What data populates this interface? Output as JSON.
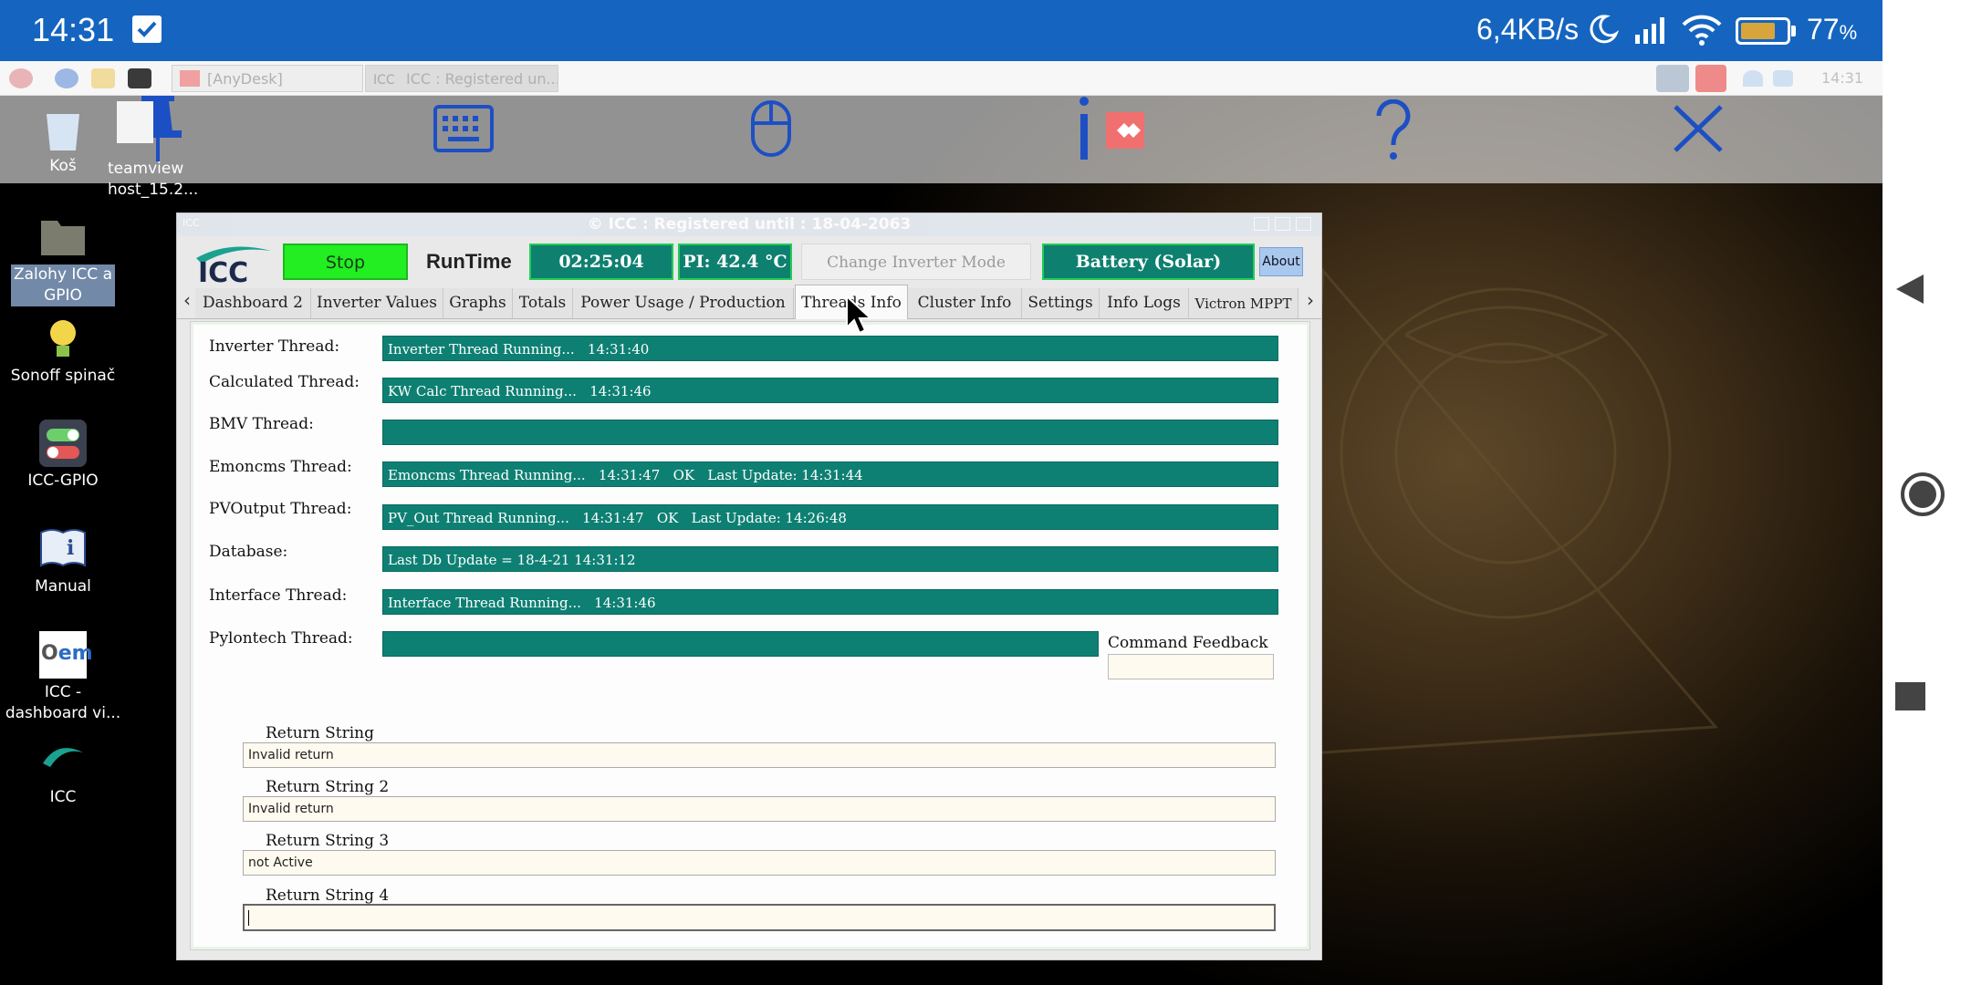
{
  "status_bar": {
    "time": "14:31",
    "net_speed": "6,4KB/s",
    "battery_pct": "77",
    "battery_unit": "%",
    "battery_level": 0.77,
    "battery_color": "#d7a53c"
  },
  "rp_taskbar": {
    "tasks": [
      "[AnyDesk]",
      "ICC : Registered un..."
    ],
    "clock": "14:31"
  },
  "desktop_icons": [
    {
      "label": "Koš"
    },
    {
      "label": "teamview\nhost_15.2..."
    },
    {
      "label": "Zalohy ICC a\nGPIO"
    },
    {
      "label": "Sonoff spinač"
    },
    {
      "label": "ICC-GPIO"
    },
    {
      "label": "Manual"
    },
    {
      "label": "ICC -\ndashboard vi..."
    },
    {
      "label": "ICC"
    }
  ],
  "window": {
    "title": "© ICC : Registered until : 18-04-2063",
    "small_title": "ICC"
  },
  "header": {
    "logo": "ICC",
    "stop": "Stop",
    "runtime_label": "RunTime",
    "runtime_value": "02:25:04",
    "pi_temp": "PI: 42.4 °C",
    "change_mode": "Change Inverter Mode",
    "battery_mode": "Battery (Solar)",
    "about": "About"
  },
  "tabs": [
    "Dashboard 2",
    "Inverter Values",
    "Graphs",
    "Totals",
    "Power Usage / Production",
    "Threads Info",
    "Cluster Info",
    "Settings",
    "Info Logs",
    "Victron MPPT"
  ],
  "active_tab": "Threads Info",
  "threads": [
    {
      "label": "Inverter Thread:",
      "value": "Inverter Thread Running...   14:31:40"
    },
    {
      "label": "Calculated Thread:",
      "value": "KW Calc Thread Running...   14:31:46"
    },
    {
      "label": "BMV Thread:",
      "value": ""
    },
    {
      "label": "Emoncms Thread:",
      "value": "Emoncms Thread Running...   14:31:47   OK   Last Update: 14:31:44"
    },
    {
      "label": "PVOutput Thread:",
      "value": "PV_Out Thread Running...   14:31:47   OK   Last Update: 14:26:48"
    },
    {
      "label": "Database:",
      "value": "Last Db Update = 18-4-21 14:31:12"
    },
    {
      "label": "Interface Thread:",
      "value": "Interface Thread Running...   14:31:46"
    },
    {
      "label": "Pylontech Thread:",
      "value": ""
    }
  ],
  "command_feedback": {
    "label": "Command Feedback",
    "value": ""
  },
  "return_strings": [
    {
      "label": "Return String",
      "value": "Invalid return"
    },
    {
      "label": "Return String 2",
      "value": "Invalid return"
    },
    {
      "label": "Return String 3",
      "value": "not Active"
    },
    {
      "label": "Return String 4",
      "value": ""
    }
  ],
  "colors": {
    "status_bar": "#1565c0",
    "thread_bar": "#0e8073",
    "stop_button": "#22ee22",
    "about_button": "#a9c8ee",
    "anydesk_blue": "#1d4fc4"
  }
}
